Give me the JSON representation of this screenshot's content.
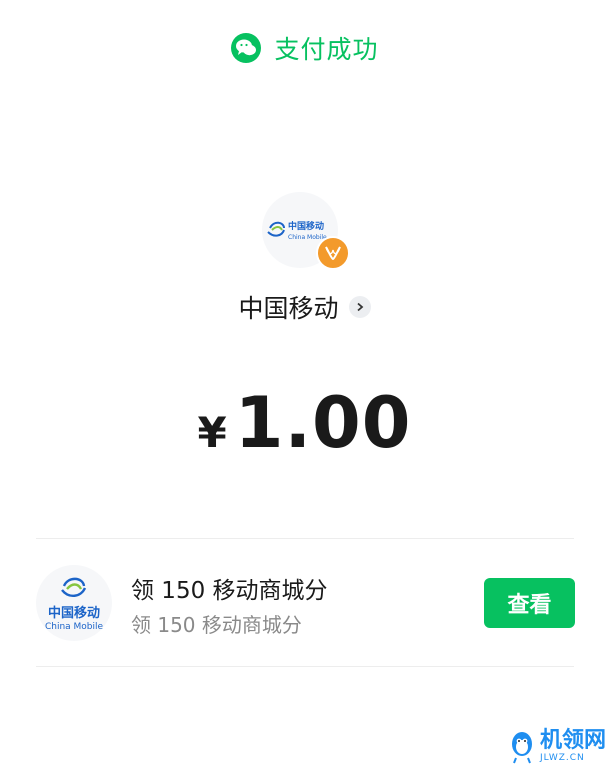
{
  "header": {
    "title": "支付成功",
    "icon": "wechat-pay-icon",
    "accent": "#07c160"
  },
  "merchant": {
    "logo_cn": "中国移动",
    "logo_en": "China Mobile",
    "name": "中国移动",
    "badge_icon": "merchant-badge-icon"
  },
  "payment": {
    "currency": "¥",
    "amount": "1.00"
  },
  "promo": {
    "logo_cn": "中国移动",
    "logo_en": "China Mobile",
    "title": "领 150 移动商城分",
    "subtitle": "领 150 移动商城分",
    "button_label": "查看"
  },
  "watermark": {
    "main": "机领网",
    "sub": "JLWZ.CN"
  }
}
